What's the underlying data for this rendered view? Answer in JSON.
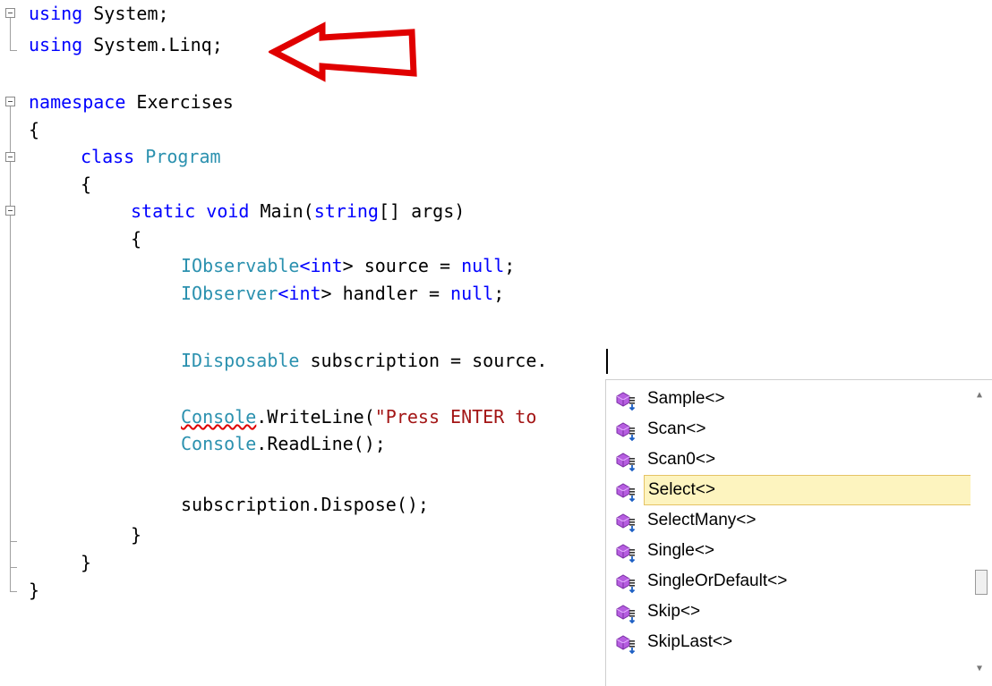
{
  "editor": {
    "lines": {
      "l1": {
        "kw": "using",
        "rest": " System;"
      },
      "l2": {
        "kw": "using",
        "rest": " System.Linq;"
      },
      "l4": {
        "kw": "namespace",
        "rest": " Exercises"
      },
      "l5": {
        "text": "{"
      },
      "l6": {
        "kw": "class",
        "ty": "Program"
      },
      "l7": {
        "text": "{"
      },
      "l8": {
        "kw1": "static",
        "kw2": "void",
        "name": " Main(",
        "kw3": "string",
        "rest": "[] args)"
      },
      "l9": {
        "text": "{"
      },
      "l10": {
        "ty": "IObservable",
        "lt": "<",
        "kw": "int",
        "rest": "> source = ",
        "kw2": "null",
        "end": ";"
      },
      "l11": {
        "ty": "IObserver",
        "lt": "<",
        "kw": "int",
        "rest": "> handler = ",
        "kw2": "null",
        "end": ";"
      },
      "l13": {
        "ty": "IDisposable",
        "rest": " subscription = source."
      },
      "l15": {
        "ty": "Console",
        "rest": ".WriteLine(",
        "str": "\"Press ENTER to"
      },
      "l16": {
        "ty": "Console",
        "rest": ".ReadLine();"
      },
      "l18": {
        "text": "subscription.Dispose();"
      },
      "l19": {
        "text": "}"
      },
      "l20": {
        "text": "}"
      },
      "l21": {
        "text": "}"
      }
    }
  },
  "completion": {
    "items": [
      {
        "label": "Sample<>"
      },
      {
        "label": "Scan<>"
      },
      {
        "label": "Scan0<>"
      },
      {
        "label": "Select<>",
        "selected": true
      },
      {
        "label": "SelectMany<>"
      },
      {
        "label": "Single<>"
      },
      {
        "label": "SingleOrDefault<>"
      },
      {
        "label": "Skip<>"
      },
      {
        "label": "SkipLast<>"
      }
    ],
    "icon": "extension-method-icon",
    "scroll_up": "▲",
    "scroll_down": "▼"
  },
  "colors": {
    "keyword": "#0000ff",
    "type": "#2b91af",
    "string": "#a31515",
    "arrow": "#e00000",
    "selection_bg": "#fdf4bf"
  }
}
